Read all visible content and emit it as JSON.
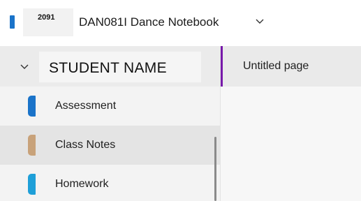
{
  "header": {
    "notebook_badge": "2091",
    "notebook_title": "DAN081I Dance Notebook",
    "notebook_icon": "notebook-icon",
    "dropdown_icon": "chevron-down-icon",
    "icon_color": "#1a73c9"
  },
  "section_group": {
    "label": "STUDENT NAME",
    "toggle_icon": "chevron-down-icon"
  },
  "sections": [
    {
      "label": "Assessment",
      "color": "#1a73c9",
      "selected": false
    },
    {
      "label": "Class Notes",
      "color": "#c8a27a",
      "selected": true
    },
    {
      "label": "Homework",
      "color": "#1e9fd8",
      "selected": false
    }
  ],
  "pages": [
    {
      "label": "Untitled page",
      "selected": true,
      "accent_color": "#7719aa"
    }
  ]
}
